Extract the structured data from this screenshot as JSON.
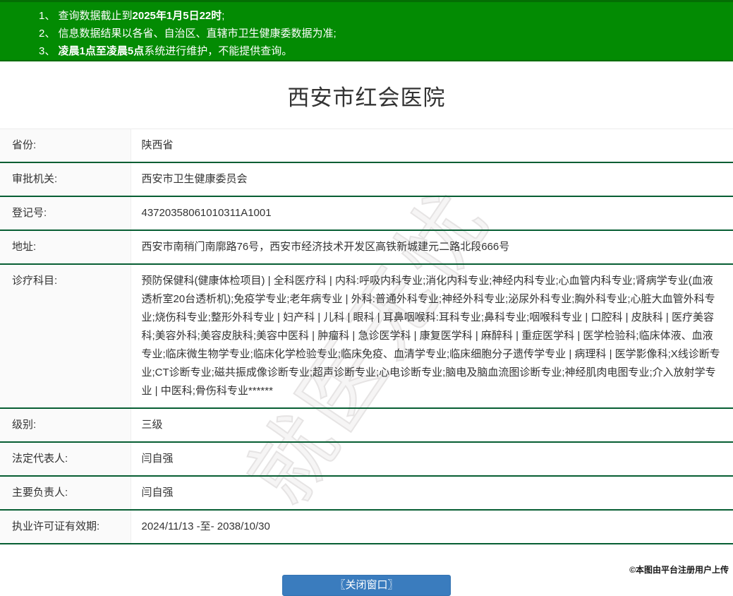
{
  "banner": {
    "lines": [
      {
        "pre": "1、 查询数据截止到",
        "bold": "2025年1月5日22时",
        "post": ";"
      },
      {
        "pre": "2、 信息数据结果以各省、自治区、直辖市卫生健康委数据为准;",
        "bold": "",
        "post": ""
      },
      {
        "pre": "3、 ",
        "bold": "凌晨1点至凌晨5点",
        "post": "系统进行维护，不能提供查询。"
      }
    ]
  },
  "title": "西安市红会医院",
  "watermark": {
    "text": "就医无忧"
  },
  "table": {
    "rows": [
      {
        "label": "省份:",
        "value": "陕西省"
      },
      {
        "label": "审批机关:",
        "value": "西安市卫生健康委员会"
      },
      {
        "label": "登记号:",
        "value": "43720358061010311A1001"
      },
      {
        "label": "地址:",
        "value": "西安市南稍门南廓路76号，西安市经济技术开发区高铁新城建元二路北段666号"
      },
      {
        "label": "诊疗科目:",
        "value": "预防保健科(健康体检项目) | 全科医疗科 | 内科:呼吸内科专业;消化内科专业;神经内科专业;心血管内科专业;肾病学专业(血液透析室20台透析机);免疫学专业;老年病专业 | 外科:普通外科专业;神经外科专业;泌尿外科专业;胸外科专业;心脏大血管外科专业;烧伤科专业;整形外科专业 | 妇产科 | 儿科 | 眼科 | 耳鼻咽喉科:耳科专业;鼻科专业;咽喉科专业 | 口腔科 | 皮肤科 | 医疗美容科;美容外科;美容皮肤科;美容中医科 | 肿瘤科 | 急诊医学科 | 康复医学科 | 麻醉科 | 重症医学科 | 医学检验科;临床体液、血液专业;临床微生物学专业;临床化学检验专业;临床免疫、血清学专业;临床细胞分子遗传学专业 | 病理科 | 医学影像科;X线诊断专业;CT诊断专业;磁共振成像诊断专业;超声诊断专业;心电诊断专业;脑电及脑血流图诊断专业;神经肌肉电图专业;介入放射学专业 | 中医科;骨伤科专业******"
      },
      {
        "label": "级别:",
        "value": "三级"
      },
      {
        "label": "法定代表人:",
        "value": "闫自强"
      },
      {
        "label": "主要负责人:",
        "value": "闫自强"
      },
      {
        "label": "执业许可证有效期:",
        "value": "2024/11/13 -至- 2038/10/30"
      }
    ]
  },
  "button": {
    "label": "〖关闭窗口〗"
  },
  "footer": {
    "credit": "©本图由平台注册用户上传"
  },
  "colors": {
    "banner_green": "#038b03",
    "separator_green": "#075e33",
    "label_bg": "#fafafa",
    "button_blue": "#3a7cbe",
    "text": "#333333"
  }
}
